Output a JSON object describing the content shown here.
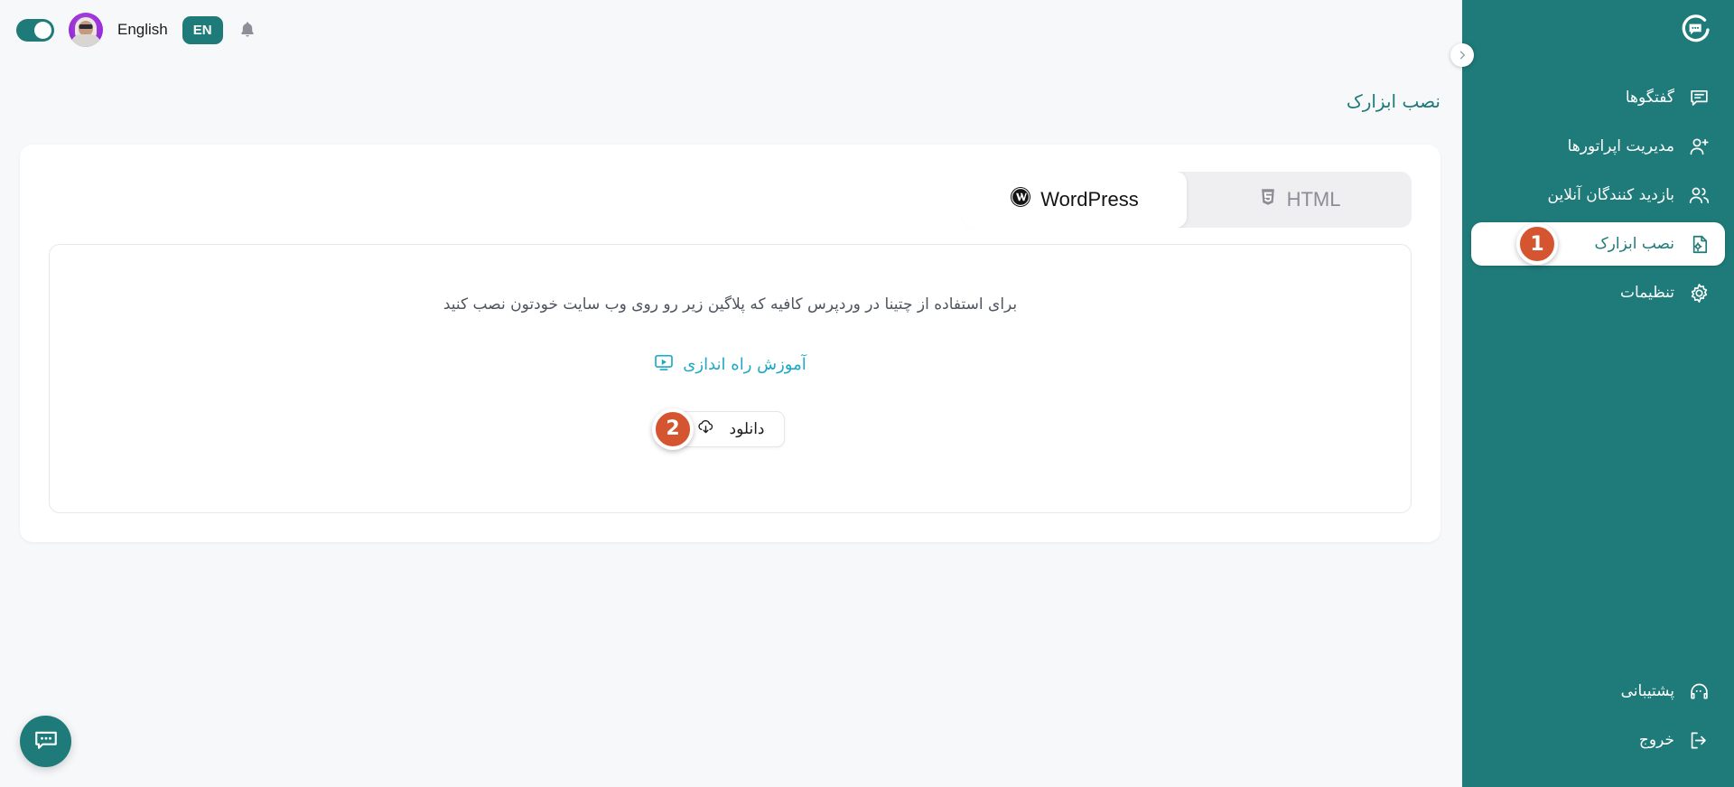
{
  "topbar": {
    "theme_toggle": "theme-toggle",
    "avatar_alt": "user-avatar",
    "language_label": "English",
    "language_code": "EN",
    "notification_icon": "bell-icon"
  },
  "sidebar": {
    "logo": "chatina-logo",
    "collapse_icon": "chevron-right-icon",
    "brand_color": "#1f7a7a",
    "items": [
      {
        "label": "گفتگوها",
        "icon": "chat-icon",
        "active": false
      },
      {
        "label": "مدیریت اپراتورها",
        "icon": "user-plus-icon",
        "active": false
      },
      {
        "label": "بازدید کنندگان آنلاین",
        "icon": "users-icon",
        "active": false
      },
      {
        "label": "نصب ابزارک",
        "icon": "file-gear-icon",
        "active": true,
        "step_badge": "1"
      },
      {
        "label": "تنظیمات",
        "icon": "gear-icon",
        "active": false
      }
    ],
    "bottom_items": [
      {
        "label": "پشتیبانی",
        "icon": "headset-icon"
      },
      {
        "label": "خروج",
        "icon": "logout-icon"
      }
    ]
  },
  "page": {
    "title": "نصب ابزارک"
  },
  "tabs": [
    {
      "label": "WordPress",
      "icon": "wordpress-icon",
      "active": true
    },
    {
      "label": "HTML",
      "icon": "html5-icon",
      "active": false
    }
  ],
  "panel": {
    "description": "برای استفاده از چتینا در وردپرس کافیه که پلاگین زیر رو روی وب سایت خودتون نصب کنید",
    "tutorial_label": "آموزش راه اندازی",
    "tutorial_icon": "video-play-icon",
    "tutorial_color": "#1ca8c6",
    "download_label": "دانلود",
    "download_icon": "cloud-download-icon",
    "download_step_badge": "2",
    "badge_color": "#d4552f"
  },
  "fab": {
    "icon": "chat-bubble-icon"
  }
}
